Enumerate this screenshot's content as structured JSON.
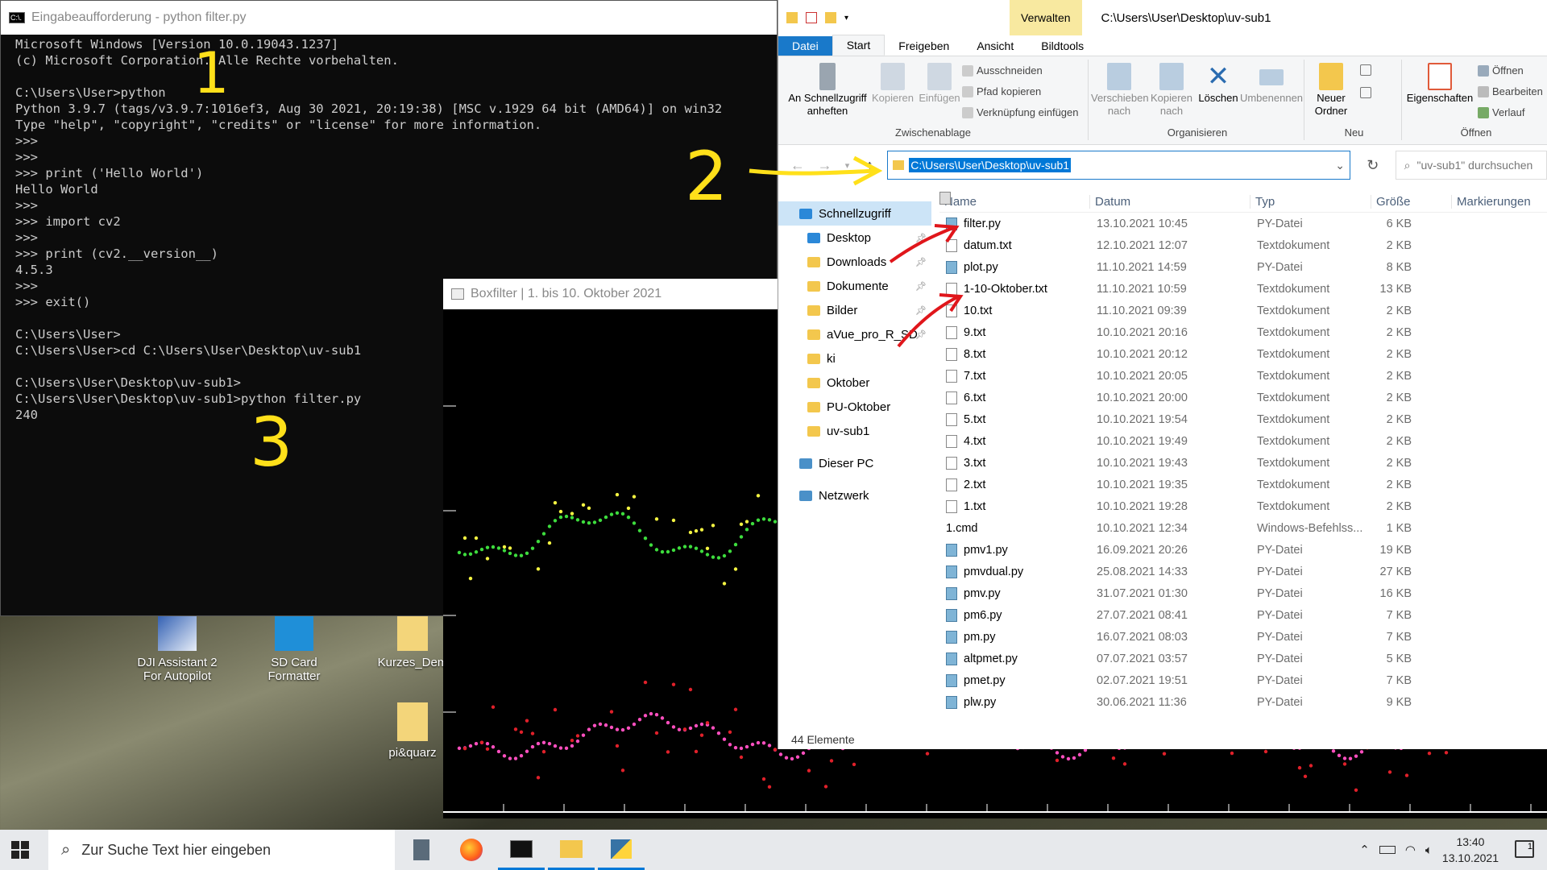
{
  "cmd": {
    "title": "Eingabeaufforderung - python  filter.py",
    "icon_text": "C:\\.",
    "lines": [
      "Microsoft Windows [Version 10.0.19043.1237]",
      "(c) Microsoft Corporation. Alle Rechte vorbehalten.",
      "",
      "C:\\Users\\User>python",
      "Python 3.9.7 (tags/v3.9.7:1016ef3, Aug 30 2021, 20:19:38) [MSC v.1929 64 bit (AMD64)] on win32",
      "Type \"help\", \"copyright\", \"credits\" or \"license\" for more information.",
      ">>>",
      ">>>",
      ">>> print ('Hello World')",
      "Hello World",
      ">>>",
      ">>> import cv2",
      ">>>",
      ">>> print (cv2.__version__)",
      "4.5.3",
      ">>>",
      ">>> exit()",
      "",
      "C:\\Users\\User>",
      "C:\\Users\\User>cd C:\\Users\\User\\Desktop\\uv-sub1",
      "",
      "C:\\Users\\User\\Desktop\\uv-sub1>",
      "C:\\Users\\User\\Desktop\\uv-sub1>python filter.py",
      "240"
    ]
  },
  "plot_window": {
    "title": "Boxfilter | 1. bis 10. Oktober 2021"
  },
  "desktop_icons": [
    {
      "label": "DJI Assistant 2 For Autopilot"
    },
    {
      "label": "SD Card Formatter"
    },
    {
      "label": "Kurzes_Dem"
    },
    {
      "label": "pi&quarz"
    }
  ],
  "annotations": {
    "one": "1",
    "two": "2",
    "three": "3"
  },
  "explorer": {
    "ctx_tab": "Verwalten",
    "path_title": "C:\\Users\\User\\Desktop\\uv-sub1",
    "tabs": [
      "Datei",
      "Start",
      "Freigeben",
      "Ansicht",
      "Bildtools"
    ],
    "ribbon": {
      "pin": "An Schnellzugriff anheften",
      "copy": "Kopieren",
      "paste": "Einfügen",
      "cut": "Ausschneiden",
      "copy_path": "Pfad kopieren",
      "paste_link": "Verknüpfung einfügen",
      "group_clipboard": "Zwischenablage",
      "move_to": "Verschieben nach",
      "copy_to": "Kopieren nach",
      "delete": "Löschen",
      "rename": "Umbenennen",
      "group_organize": "Organisieren",
      "new_folder": "Neuer Ordner",
      "group_new": "Neu",
      "properties": "Eigenschaften",
      "open": "Öffnen",
      "edit": "Bearbeiten",
      "history": "Verlauf",
      "group_open": "Öffnen"
    },
    "address": "C:\\Users\\User\\Desktop\\uv-sub1",
    "search_placeholder": "\"uv-sub1\" durchsuchen",
    "nav": [
      {
        "label": "Schnellzugriff",
        "pinned": false
      },
      {
        "label": "Desktop",
        "pinned": true
      },
      {
        "label": "Downloads",
        "pinned": true
      },
      {
        "label": "Dokumente",
        "pinned": true
      },
      {
        "label": "Bilder",
        "pinned": true
      },
      {
        "label": "aVue_pro_R_SD",
        "pinned": true
      },
      {
        "label": "ki",
        "pinned": false
      },
      {
        "label": "Oktober",
        "pinned": false
      },
      {
        "label": "PU-Oktober",
        "pinned": false
      },
      {
        "label": "uv-sub1",
        "pinned": false
      },
      {
        "label": "Dieser PC",
        "pinned": false
      },
      {
        "label": "Netzwerk",
        "pinned": false
      }
    ],
    "columns": [
      "Name",
      "Datum",
      "Typ",
      "Größe",
      "Markierungen"
    ],
    "files": [
      {
        "name": "filter.py",
        "date": "13.10.2021 10:45",
        "type": "PY-Datei",
        "size": "6 KB",
        "kind": "py"
      },
      {
        "name": "datum.txt",
        "date": "12.10.2021 12:07",
        "type": "Textdokument",
        "size": "2 KB",
        "kind": "txt"
      },
      {
        "name": "plot.py",
        "date": "11.10.2021 14:59",
        "type": "PY-Datei",
        "size": "8 KB",
        "kind": "py"
      },
      {
        "name": "1-10-Oktober.txt",
        "date": "11.10.2021 10:59",
        "type": "Textdokument",
        "size": "13 KB",
        "kind": "txt"
      },
      {
        "name": "10.txt",
        "date": "11.10.2021 09:39",
        "type": "Textdokument",
        "size": "2 KB",
        "kind": "txt"
      },
      {
        "name": "9.txt",
        "date": "10.10.2021 20:16",
        "type": "Textdokument",
        "size": "2 KB",
        "kind": "txt"
      },
      {
        "name": "8.txt",
        "date": "10.10.2021 20:12",
        "type": "Textdokument",
        "size": "2 KB",
        "kind": "txt"
      },
      {
        "name": "7.txt",
        "date": "10.10.2021 20:05",
        "type": "Textdokument",
        "size": "2 KB",
        "kind": "txt"
      },
      {
        "name": "6.txt",
        "date": "10.10.2021 20:00",
        "type": "Textdokument",
        "size": "2 KB",
        "kind": "txt"
      },
      {
        "name": "5.txt",
        "date": "10.10.2021 19:54",
        "type": "Textdokument",
        "size": "2 KB",
        "kind": "txt"
      },
      {
        "name": "4.txt",
        "date": "10.10.2021 19:49",
        "type": "Textdokument",
        "size": "2 KB",
        "kind": "txt"
      },
      {
        "name": "3.txt",
        "date": "10.10.2021 19:43",
        "type": "Textdokument",
        "size": "2 KB",
        "kind": "txt"
      },
      {
        "name": "2.txt",
        "date": "10.10.2021 19:35",
        "type": "Textdokument",
        "size": "2 KB",
        "kind": "txt"
      },
      {
        "name": "1.txt",
        "date": "10.10.2021 19:28",
        "type": "Textdokument",
        "size": "2 KB",
        "kind": "txt"
      },
      {
        "name": "1.cmd",
        "date": "10.10.2021 12:34",
        "type": "Windows-Befehlss...",
        "size": "1 KB",
        "kind": "cmd"
      },
      {
        "name": "pmv1.py",
        "date": "16.09.2021 20:26",
        "type": "PY-Datei",
        "size": "19 KB",
        "kind": "py"
      },
      {
        "name": "pmvdual.py",
        "date": "25.08.2021 14:33",
        "type": "PY-Datei",
        "size": "27 KB",
        "kind": "py"
      },
      {
        "name": "pmv.py",
        "date": "31.07.2021 01:30",
        "type": "PY-Datei",
        "size": "16 KB",
        "kind": "py"
      },
      {
        "name": "pm6.py",
        "date": "27.07.2021 08:41",
        "type": "PY-Datei",
        "size": "7 KB",
        "kind": "py"
      },
      {
        "name": "pm.py",
        "date": "16.07.2021 08:03",
        "type": "PY-Datei",
        "size": "7 KB",
        "kind": "py"
      },
      {
        "name": "altpmet.py",
        "date": "07.07.2021 03:57",
        "type": "PY-Datei",
        "size": "5 KB",
        "kind": "py"
      },
      {
        "name": "pmet.py",
        "date": "02.07.2021 19:51",
        "type": "PY-Datei",
        "size": "7 KB",
        "kind": "py"
      },
      {
        "name": "plw.py",
        "date": "30.06.2021 11:36",
        "type": "PY-Datei",
        "size": "9 KB",
        "kind": "py"
      }
    ],
    "status": "44 Elemente"
  },
  "taskbar": {
    "search_placeholder": "Zur Suche Text hier eingeben",
    "time": "13:40",
    "date": "13.10.2021",
    "notification_count": "1"
  }
}
